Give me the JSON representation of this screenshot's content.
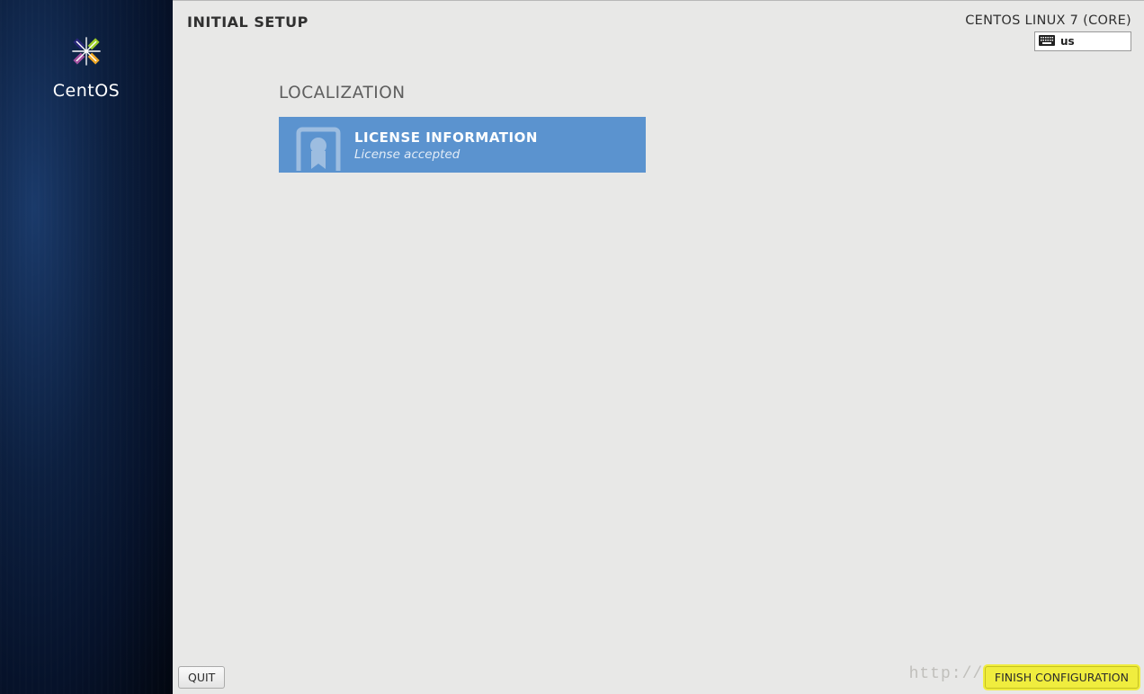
{
  "sidebar": {
    "brand": "CentOS",
    "logo_icon": "centos-logo-icon"
  },
  "header": {
    "title": "INITIAL SETUP",
    "distro": "CENTOS LINUX 7 (CORE)",
    "keyboard": {
      "icon": "keyboard-icon",
      "layout": "us"
    }
  },
  "content": {
    "section_title": "LOCALIZATION",
    "spokes": [
      {
        "icon": "license-icon",
        "title": "LICENSE INFORMATION",
        "status": "License accepted",
        "selected": true
      }
    ]
  },
  "footer": {
    "quit_label": "QUIT",
    "finish_label": "FINISH CONFIGURATION"
  },
  "watermark": "http://blog.c"
}
